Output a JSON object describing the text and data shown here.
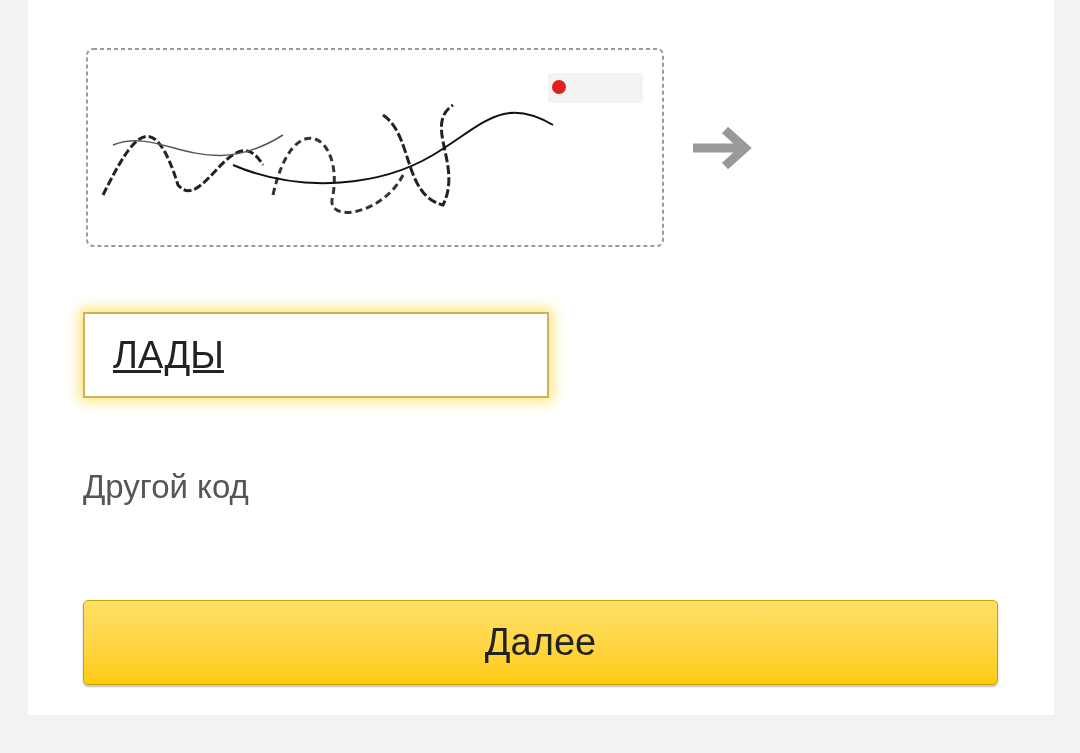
{
  "answer": {
    "value": "ЛАДЫ",
    "focused": true
  },
  "other_code_link": "Другой код",
  "next_button": "Далее"
}
